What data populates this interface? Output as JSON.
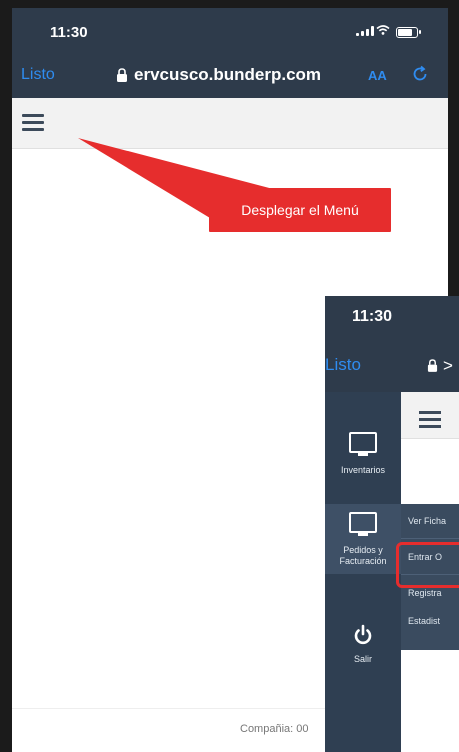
{
  "phone1": {
    "status": {
      "time": "11:30"
    },
    "browser": {
      "done_label": "Listo",
      "url": "ervcusco.bunderp.com",
      "text_size_label": "AA"
    },
    "footer": {
      "company_text": "Compañia: 00"
    }
  },
  "callout": {
    "text": "Desplegar el Menú"
  },
  "phone2": {
    "status": {
      "time": "11:30"
    },
    "browser": {
      "done_label": "Listo",
      "url_fragment": ">"
    },
    "sidebar": {
      "items": [
        {
          "label": "Inventarios",
          "icon": "monitor-icon"
        },
        {
          "label": "Pedidos y Facturación",
          "icon": "monitor-icon"
        },
        {
          "label": "Salir",
          "icon": "power-icon"
        }
      ]
    },
    "submenu": {
      "items": [
        {
          "label": "Ver Ficha"
        },
        {
          "label": "Entrar O"
        },
        {
          "label": "Registra"
        },
        {
          "label": "Estadist"
        }
      ]
    }
  },
  "colors": {
    "header": "#2e3b4b",
    "link": "#2f8cf0",
    "callout": "#e62d2d",
    "sidebar": "#2f3f52"
  }
}
